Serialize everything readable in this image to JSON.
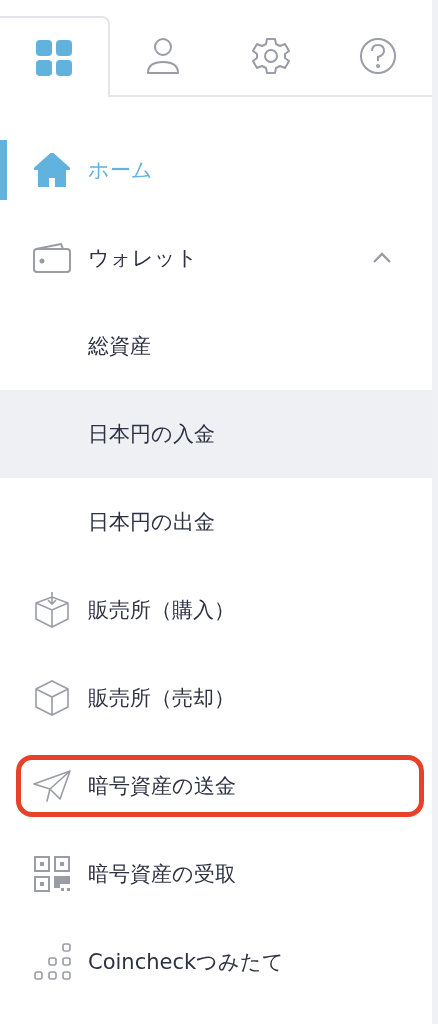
{
  "tabs": [
    {
      "kind": "grid",
      "selected": true
    },
    {
      "kind": "user",
      "selected": false
    },
    {
      "kind": "gear",
      "selected": false
    },
    {
      "kind": "help",
      "selected": false
    }
  ],
  "menu": [
    {
      "label": "ホーム",
      "kind": "home",
      "selected": true,
      "outlined": false
    },
    {
      "label": "ウォレット",
      "kind": "wallet",
      "selected": false,
      "outlined": false,
      "expanded": true,
      "children": [
        {
          "label": "総資産",
          "hovered": false
        },
        {
          "label": "日本円の入金",
          "hovered": true
        },
        {
          "label": "日本円の出金",
          "hovered": false
        }
      ]
    },
    {
      "label": "販売所（購入）",
      "kind": "box-in",
      "selected": false,
      "outlined": false
    },
    {
      "label": "販売所（売却）",
      "kind": "box",
      "selected": false,
      "outlined": false
    },
    {
      "label": "暗号資産の送金",
      "kind": "plane",
      "selected": false,
      "outlined": true
    },
    {
      "label": "暗号資産の受取",
      "kind": "qr",
      "selected": false,
      "outlined": false
    },
    {
      "label": "Coincheckつみたて",
      "kind": "blocks",
      "selected": false,
      "outlined": false
    }
  ]
}
